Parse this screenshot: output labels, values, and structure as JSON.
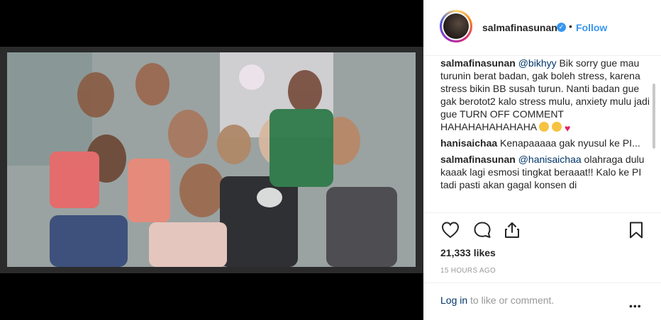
{
  "post": {
    "photo_alt": "group selfie",
    "username": "salmafinasunan",
    "verified_symbol": "✓",
    "dot": "•",
    "follow_label": "Follow"
  },
  "comments": [
    {
      "user": "salmafinasunan",
      "mention": "@bikhyy",
      "text": " Bik sorry gue mau turunin berat badan, gak boleh stress, karena stress bikin BB susah turun. Nanti badan gue gak berotot2 kalo stress mulu, anxiety mulu jadi gue TURN OFF COMMENT HAHAHAHAHAHAHA",
      "emojis": [
        "rolling-on-floor-laughing-emoji",
        "hugging-face-emoji",
        "red-heart-emoji"
      ]
    },
    {
      "user": "hanisaichaa",
      "mention": "",
      "text": " Kenapaaaaa gak nyusul ke PI..."
    },
    {
      "user": "salmafinasunan",
      "mention": "@hanisaichaa",
      "text": " olahraga dulu kaaak lagi esmosi tingkat beraaat!! Kalo ke PI tadi pasti akan gagal konsen di"
    }
  ],
  "actions": {
    "icons": [
      "heart-icon",
      "comment-icon",
      "share-icon",
      "bookmark-icon"
    ],
    "likes": "21,333 likes",
    "timestamp": "15 HOURS AGO"
  },
  "add_comment": {
    "login_link": "Log in",
    "rest": " to like or comment.",
    "more": "•••"
  },
  "colors": {
    "link_blue": "#3897f0",
    "mention_navy": "#003569",
    "muted": "#999999",
    "text": "#262626"
  }
}
